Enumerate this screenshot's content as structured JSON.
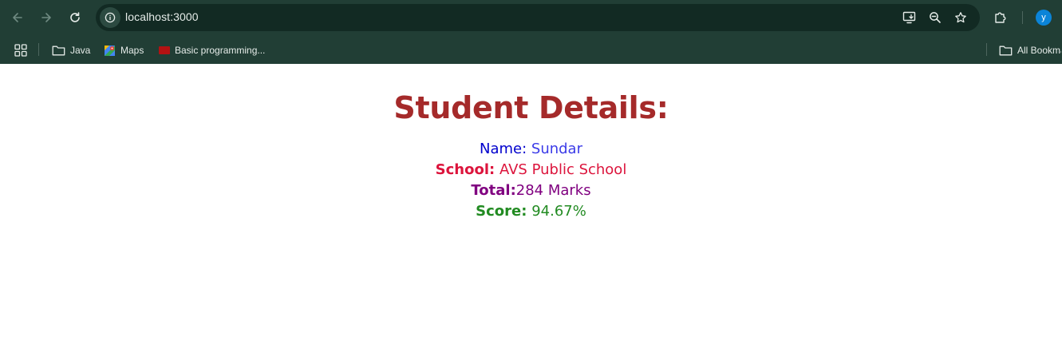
{
  "browser": {
    "url": "localhost:3000",
    "avatar_letter": "y",
    "bookmarks": [
      {
        "label": "Java",
        "icon": "folder-icon"
      },
      {
        "label": "Maps",
        "icon": "maps-icon"
      },
      {
        "label": "Basic programming...",
        "icon": "bookmark-favicon-icon"
      }
    ],
    "all_bookmarks_label": "All Bookmarks"
  },
  "page": {
    "heading": "Student Details:",
    "name_label": "Name:",
    "name_value": "Sundar",
    "school_label": "School:",
    "school_value": "AVS Public School",
    "total_label": "Total:",
    "total_value": "284 Marks",
    "score_label": "Score:",
    "score_value": "94.67%"
  },
  "colors": {
    "chrome_bg": "#213e35",
    "omnibox_bg": "#122a23",
    "heading": "#a52a2a",
    "name": "#0000cd",
    "school": "#dc143c",
    "total": "#800080",
    "score": "#228b22",
    "avatar": "#0b84d8"
  }
}
